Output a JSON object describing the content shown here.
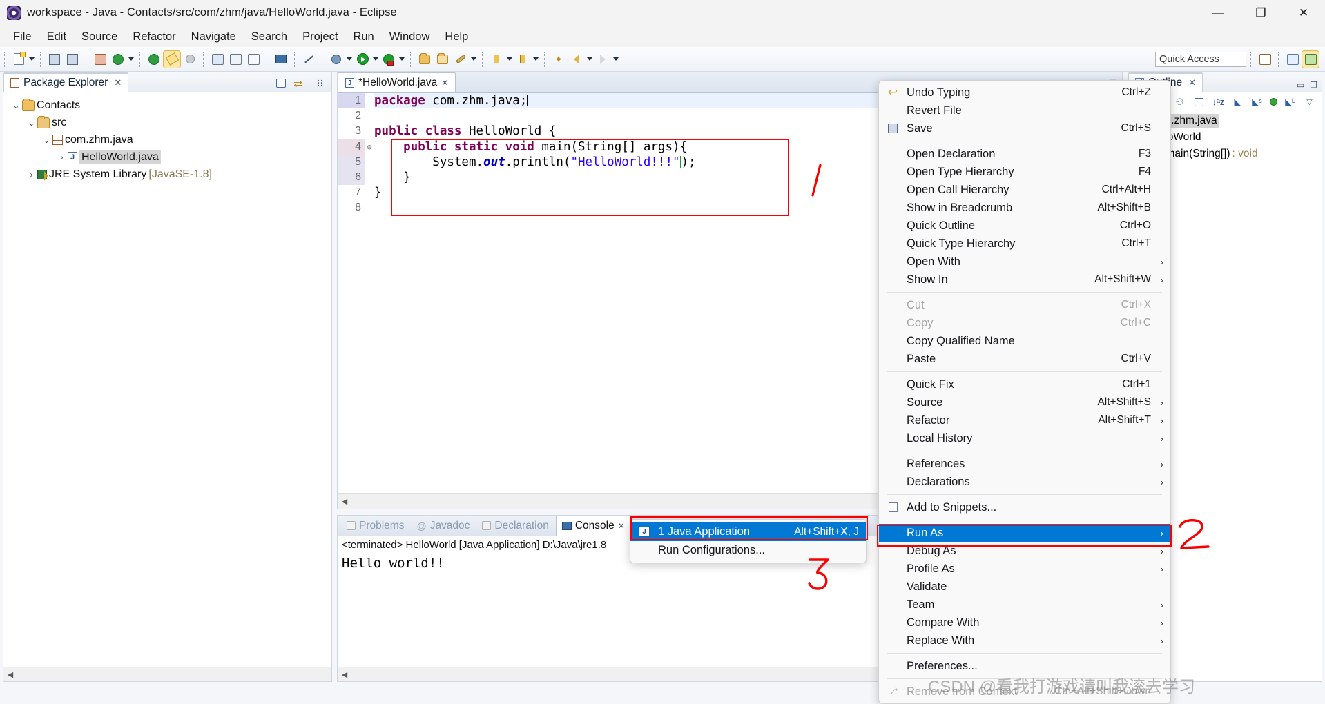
{
  "window": {
    "title": "workspace - Java - Contacts/src/com/zhm/java/HelloWorld.java - Eclipse",
    "minimize": "—",
    "restore": "❐",
    "close": "✕"
  },
  "menubar": [
    "File",
    "Edit",
    "Source",
    "Refactor",
    "Navigate",
    "Search",
    "Project",
    "Run",
    "Window",
    "Help"
  ],
  "toolbar": {
    "quick_access_placeholder": "Quick Access"
  },
  "package_explorer": {
    "tab_label": "Package Explorer",
    "close_glyph": "✕",
    "tree": [
      {
        "indent": 0,
        "twist": "⌄",
        "icon": "project-folder-icon",
        "label": "Contacts",
        "suffix": "",
        "selected": false
      },
      {
        "indent": 1,
        "twist": "⌄",
        "icon": "source-folder-icon",
        "label": "src",
        "suffix": "",
        "selected": false
      },
      {
        "indent": 2,
        "twist": "⌄",
        "icon": "package-icon",
        "label": "com.zhm.java",
        "suffix": "",
        "selected": false
      },
      {
        "indent": 3,
        "twist": "›",
        "icon": "java-file-icon",
        "label": "HelloWorld.java",
        "suffix": "",
        "selected": true
      },
      {
        "indent": 1,
        "twist": "›",
        "icon": "library-icon",
        "label": "JRE System Library",
        "suffix": "[JavaSE-1.8]",
        "selected": false
      }
    ]
  },
  "editor": {
    "tab_label": "*HelloWorld.java",
    "close_glyph": "✕",
    "lines": [
      {
        "num": "1",
        "fold": "",
        "state": "cur",
        "tokens": [
          {
            "t": "package",
            "c": "kw"
          },
          {
            "t": " com.zhm.java;",
            "c": "plain"
          },
          {
            "t": "|caret|",
            "c": "caret"
          }
        ]
      },
      {
        "num": "2",
        "fold": "",
        "state": "",
        "tokens": []
      },
      {
        "num": "3",
        "fold": "",
        "state": "",
        "tokens": [
          {
            "t": "public class ",
            "c": "kw"
          },
          {
            "t": "HelloWorld {",
            "c": "plain"
          }
        ]
      },
      {
        "num": "4",
        "fold": "⊖",
        "state": "hl",
        "tokens": [
          {
            "t": "    ",
            "c": "plain"
          },
          {
            "t": "public static void ",
            "c": "kw"
          },
          {
            "t": "main(String[] args){",
            "c": "plain"
          }
        ]
      },
      {
        "num": "5",
        "fold": "",
        "state": "shade",
        "tokens": [
          {
            "t": "        System.",
            "c": "plain"
          },
          {
            "t": "out",
            "c": "fld"
          },
          {
            "t": ".println(",
            "c": "plain"
          },
          {
            "t": "\"HelloWorld!!!\"",
            "c": "str"
          },
          {
            "t": "|green|",
            "c": "caretg"
          },
          {
            "t": ");",
            "c": "plain"
          }
        ]
      },
      {
        "num": "6",
        "fold": "",
        "state": "shade",
        "tokens": [
          {
            "t": "    }",
            "c": "plain"
          }
        ]
      },
      {
        "num": "7",
        "fold": "",
        "state": "",
        "tokens": [
          {
            "t": "}",
            "c": "plain"
          }
        ]
      },
      {
        "num": "8",
        "fold": "",
        "state": "",
        "tokens": []
      }
    ]
  },
  "console": {
    "tabs": [
      {
        "label": "Problems",
        "icon": "problems-icon",
        "active": false
      },
      {
        "label": "Javadoc",
        "icon": "javadoc-icon",
        "active": false
      },
      {
        "label": "Declaration",
        "icon": "declaration-icon",
        "active": false
      },
      {
        "label": "Console",
        "icon": "console-icon",
        "active": true
      }
    ],
    "close_glyph": "✕",
    "terminated_line": "<terminated> HelloWorld [Java Application] D:\\Java\\jre1.8",
    "output": "Hello world!!"
  },
  "outline": {
    "tab_label": "Outline",
    "close_glyph": "✕",
    "items": [
      {
        "indent": 0,
        "icon": "package-icon",
        "label": "com.zhm.java",
        "suffix": "",
        "selected": true
      },
      {
        "indent": 0,
        "icon": "class-icon",
        "label": "HelloWorld",
        "suffix": "",
        "selected": false
      },
      {
        "indent": 1,
        "icon": "method-icon",
        "label": "main(String[])",
        "suffix": ": void",
        "selected": false
      }
    ]
  },
  "context_menu": {
    "items": [
      {
        "label": "Undo Typing",
        "accel": "Ctrl+Z",
        "icon": "undo-icon",
        "arrow": false,
        "disabled": false,
        "selected": false
      },
      {
        "label": "Revert File",
        "accel": "",
        "icon": "",
        "arrow": false,
        "disabled": false,
        "selected": false
      },
      {
        "label": "Save",
        "accel": "Ctrl+S",
        "icon": "save-icon",
        "arrow": false,
        "disabled": false,
        "selected": false
      },
      {
        "separator": true
      },
      {
        "label": "Open Declaration",
        "accel": "F3",
        "icon": "",
        "arrow": false,
        "disabled": false,
        "selected": false
      },
      {
        "label": "Open Type Hierarchy",
        "accel": "F4",
        "icon": "",
        "arrow": false,
        "disabled": false,
        "selected": false
      },
      {
        "label": "Open Call Hierarchy",
        "accel": "Ctrl+Alt+H",
        "icon": "",
        "arrow": false,
        "disabled": false,
        "selected": false
      },
      {
        "label": "Show in Breadcrumb",
        "accel": "Alt+Shift+B",
        "icon": "",
        "arrow": false,
        "disabled": false,
        "selected": false
      },
      {
        "label": "Quick Outline",
        "accel": "Ctrl+O",
        "icon": "",
        "arrow": false,
        "disabled": false,
        "selected": false
      },
      {
        "label": "Quick Type Hierarchy",
        "accel": "Ctrl+T",
        "icon": "",
        "arrow": false,
        "disabled": false,
        "selected": false
      },
      {
        "label": "Open With",
        "accel": "",
        "icon": "",
        "arrow": true,
        "disabled": false,
        "selected": false
      },
      {
        "label": "Show In",
        "accel": "Alt+Shift+W",
        "icon": "",
        "arrow": true,
        "disabled": false,
        "selected": false
      },
      {
        "separator": true
      },
      {
        "label": "Cut",
        "accel": "Ctrl+X",
        "icon": "",
        "arrow": false,
        "disabled": true,
        "selected": false
      },
      {
        "label": "Copy",
        "accel": "Ctrl+C",
        "icon": "",
        "arrow": false,
        "disabled": true,
        "selected": false
      },
      {
        "label": "Copy Qualified Name",
        "accel": "",
        "icon": "",
        "arrow": false,
        "disabled": false,
        "selected": false
      },
      {
        "label": "Paste",
        "accel": "Ctrl+V",
        "icon": "",
        "arrow": false,
        "disabled": false,
        "selected": false
      },
      {
        "separator": true
      },
      {
        "label": "Quick Fix",
        "accel": "Ctrl+1",
        "icon": "",
        "arrow": false,
        "disabled": false,
        "selected": false
      },
      {
        "label": "Source",
        "accel": "Alt+Shift+S",
        "icon": "",
        "arrow": true,
        "disabled": false,
        "selected": false
      },
      {
        "label": "Refactor",
        "accel": "Alt+Shift+T",
        "icon": "",
        "arrow": true,
        "disabled": false,
        "selected": false
      },
      {
        "label": "Local History",
        "accel": "",
        "icon": "",
        "arrow": true,
        "disabled": false,
        "selected": false
      },
      {
        "separator": true
      },
      {
        "label": "References",
        "accel": "",
        "icon": "",
        "arrow": true,
        "disabled": false,
        "selected": false
      },
      {
        "label": "Declarations",
        "accel": "",
        "icon": "",
        "arrow": true,
        "disabled": false,
        "selected": false
      },
      {
        "separator": true
      },
      {
        "label": "Add to Snippets...",
        "accel": "",
        "icon": "snippets-icon",
        "arrow": false,
        "disabled": false,
        "selected": false
      },
      {
        "separator": true
      },
      {
        "label": "Run As",
        "accel": "",
        "icon": "",
        "arrow": true,
        "disabled": false,
        "selected": true
      },
      {
        "label": "Debug As",
        "accel": "",
        "icon": "",
        "arrow": true,
        "disabled": false,
        "selected": false
      },
      {
        "label": "Profile As",
        "accel": "",
        "icon": "",
        "arrow": true,
        "disabled": false,
        "selected": false
      },
      {
        "label": "Validate",
        "accel": "",
        "icon": "",
        "arrow": false,
        "disabled": false,
        "selected": false
      },
      {
        "label": "Team",
        "accel": "",
        "icon": "",
        "arrow": true,
        "disabled": false,
        "selected": false
      },
      {
        "label": "Compare With",
        "accel": "",
        "icon": "",
        "arrow": true,
        "disabled": false,
        "selected": false
      },
      {
        "label": "Replace With",
        "accel": "",
        "icon": "",
        "arrow": true,
        "disabled": false,
        "selected": false
      },
      {
        "separator": true
      },
      {
        "label": "Preferences...",
        "accel": "",
        "icon": "",
        "arrow": false,
        "disabled": false,
        "selected": false
      },
      {
        "separator": true
      },
      {
        "label": "Remove from Context",
        "accel": "Ctrl+Alt+Shift+Down",
        "icon": "remove-context-icon",
        "arrow": false,
        "disabled": true,
        "selected": false
      }
    ]
  },
  "run_as_submenu": {
    "items": [
      {
        "label": "1 Java Application",
        "accel": "Alt+Shift+X, J",
        "icon": "java-app-icon",
        "selected": true
      },
      {
        "label": "Run Configurations...",
        "accel": "",
        "icon": "",
        "selected": false
      }
    ]
  },
  "annotations": {
    "mark_1": "1",
    "mark_2": "2",
    "mark_3": "3",
    "highlight_color": "#fb0000"
  },
  "watermark": "CSDN @看我打游戏请叫我滚去学习"
}
